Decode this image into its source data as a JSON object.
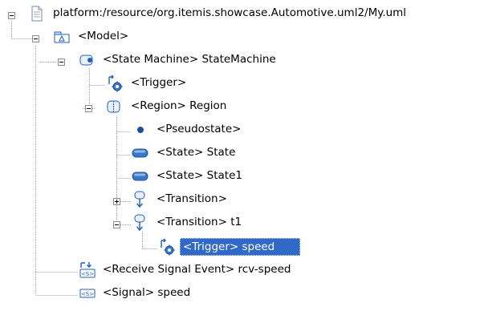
{
  "tree": {
    "root": {
      "label": "platform:/resource/org.itemis.showcase.Automotive.uml2/My.uml",
      "icon": "document-icon"
    },
    "model": {
      "label": "<Model>",
      "icon": "model-package-icon"
    },
    "state_machine": {
      "label": "<State Machine> StateMachine",
      "icon": "state-machine-icon"
    },
    "trigger_sm": {
      "label": "<Trigger>",
      "icon": "trigger-icon"
    },
    "region": {
      "label": "<Region> Region",
      "icon": "region-icon"
    },
    "pseudostate": {
      "label": "<Pseudostate>",
      "icon": "pseudostate-icon"
    },
    "state": {
      "label": "<State> State",
      "icon": "state-icon"
    },
    "state1": {
      "label": "<State> State1",
      "icon": "state-icon"
    },
    "transition": {
      "label": "<Transition>",
      "icon": "transition-icon"
    },
    "transition_t1": {
      "label": "<Transition> t1",
      "icon": "transition-icon"
    },
    "trigger_speed": {
      "label": "<Trigger> speed",
      "icon": "trigger-icon",
      "selected": true
    },
    "receive_signal_event": {
      "label": "<Receive Signal Event>  rcv-speed",
      "icon": "receive-signal-event-icon"
    },
    "signal": {
      "label": "<Signal> speed",
      "icon": "signal-icon"
    }
  },
  "colors": {
    "selection": "#3169c6",
    "tree_lines": "#a0a0a0",
    "icon_blue": "#1f5fbf"
  }
}
